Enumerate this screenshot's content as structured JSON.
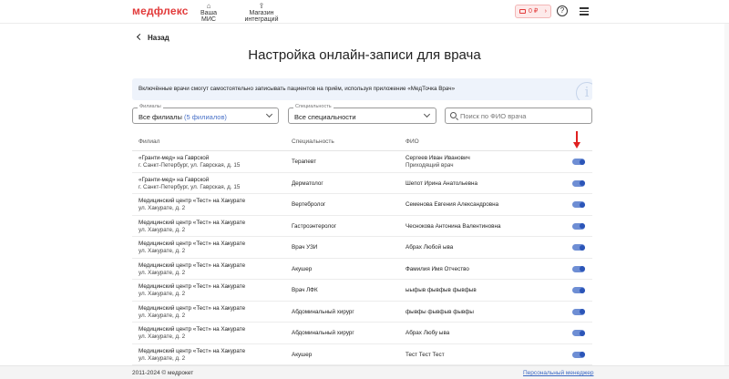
{
  "nav": {
    "logo": "медфлекс",
    "items": [
      {
        "label": "Ваша МИС",
        "icon": "home-plus-icon"
      },
      {
        "label": "Магазин интеграций",
        "icon": "share-icon"
      }
    ],
    "balance": "0 ₽",
    "help": "?"
  },
  "page": {
    "back_label": "Назад",
    "title": "Настройка онлайн-записи для врача",
    "info_text": "Включённые врачи смогут самостоятельно записывать пациентов на приём, используя приложение «МедТочка Врач»"
  },
  "filters": {
    "branch": {
      "label": "Филиалы",
      "value": "Все филиалы",
      "count": "(5 филиалов)"
    },
    "specialty": {
      "label": "Специальность",
      "value": "Все специальности"
    },
    "search": {
      "placeholder": "Поиск по ФИО врача",
      "value": ""
    }
  },
  "table": {
    "headers": {
      "branch": "Филиал",
      "specialty": "Специальность",
      "name": "ФИО"
    },
    "rows": [
      {
        "branch": "«Гранти-мед» на Гаврской",
        "address": "г. Санкт-Петербург, ул. Гаврская, д. 15",
        "specialty": "Терапевт",
        "name": "Сергеев Иван Иванович",
        "note": "Приходящий врач",
        "enabled": true
      },
      {
        "branch": "«Гранти-мед» на Гаврской",
        "address": "г. Санкт-Петербург, ул. Гаврская, д. 15",
        "specialty": "Дерматолог",
        "name": "Шепот Ирина Анатольевна",
        "note": "",
        "enabled": true
      },
      {
        "branch": "Медицинский центр «Тест» на Хакурате",
        "address": "ул. Хакурате, д. 2",
        "specialty": "Вертебролог",
        "name": "Семенова Евгения Александровна",
        "note": "",
        "enabled": true
      },
      {
        "branch": "Медицинский центр «Тест» на Хакурате",
        "address": "ул. Хакурате, д. 2",
        "specialty": "Гастроэнтеролог",
        "name": "Чеснокова Антонина Валентиновна",
        "note": "",
        "enabled": true
      },
      {
        "branch": "Медицинский центр «Тест» на Хакурате",
        "address": "ул. Хакурате, д. 2",
        "specialty": "Врач УЗИ",
        "name": "Абрах Любой ыва",
        "note": "",
        "enabled": true
      },
      {
        "branch": "Медицинский центр «Тест» на Хакурате",
        "address": "ул. Хакурате, д. 2",
        "specialty": "Акушер",
        "name": "Фамилия Имя Отчество",
        "note": "",
        "enabled": true
      },
      {
        "branch": "Медицинский центр «Тест» на Хакурате",
        "address": "ул. Хакурате, д. 2",
        "specialty": "Врач ЛФК",
        "name": "ыыфыв фывфыв фывфыв",
        "note": "",
        "enabled": true
      },
      {
        "branch": "Медицинский центр «Тест» на Хакурате",
        "address": "ул. Хакурате, д. 2",
        "specialty": "Абдоминальный хирург",
        "name": "фывфы фывфыв фывфы",
        "note": "",
        "enabled": true
      },
      {
        "branch": "Медицинский центр «Тест» на Хакурате",
        "address": "ул. Хакурате, д. 2",
        "specialty": "Абдоминальный хирург",
        "name": "Абрах Любу ыва",
        "note": "",
        "enabled": true
      },
      {
        "branch": "Медицинский центр «Тест» на Хакурате",
        "address": "ул. Хакурате, д. 2",
        "specialty": "Акушер",
        "name": "Тест Тест Тест",
        "note": "",
        "enabled": true
      }
    ]
  },
  "footer": {
    "copyright": "2011-2024 © медрокет",
    "manager_link": "Персональный менеджер"
  },
  "colors": {
    "brand": "#e23b3b",
    "toggle_on": "#2b55b8",
    "link": "#3a68c4",
    "annotation_arrow": "#e02020"
  }
}
